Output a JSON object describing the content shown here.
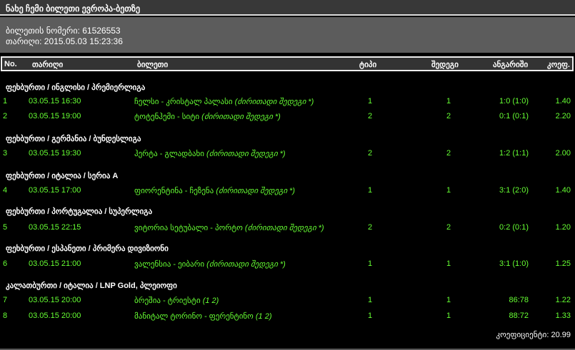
{
  "title": "ნახე ჩემი ბილეთი ევროპა-ბეთზე",
  "info": {
    "ticket_label": "ბილეთის ნომერი:",
    "ticket_number": "61526553",
    "date_label": "თარიღი:",
    "date": "2015.05.03 15:23:36"
  },
  "headers": {
    "no": "No.",
    "date": "თარიღი",
    "ticket": "ბილეთი",
    "type": "ტიპი",
    "result": "შედეგი",
    "score": "ანგარიში",
    "coef": "კოეფ."
  },
  "colors": {
    "row_text": "#66ff33",
    "title_bg": "#383838",
    "info_bg": "#5c5c5c"
  },
  "groups": [
    {
      "label": "ფეხბურთი / ინგლისი / პრემიერლიგა",
      "rows": [
        {
          "no": "1",
          "date": "03.05.15 16:30",
          "match": "ჩელსი - კრისტალ პალასი",
          "note": "(ძირითადი შედეგი *)",
          "type": "1",
          "result": "1",
          "score": "1:0 (1:0)",
          "coef": "1.40"
        },
        {
          "no": "2",
          "date": "03.05.15 19:00",
          "match": "ტოტენჰემი - სიტი",
          "note": "(ძირითადი შედეგი *)",
          "type": "2",
          "result": "2",
          "score": "0:1 (0:1)",
          "coef": "2.20"
        }
      ]
    },
    {
      "label": "ფეხბურთი / გერმანია / ბუნდესლიგა",
      "rows": [
        {
          "no": "3",
          "date": "03.05.15 19:30",
          "match": "ჰერტა - გლადბახი",
          "note": "(ძირითადი შედეგი *)",
          "type": "2",
          "result": "2",
          "score": "1:2 (1:1)",
          "coef": "2.00"
        }
      ]
    },
    {
      "label": "ფეხბურთი / იტალია / სერია A",
      "rows": [
        {
          "no": "4",
          "date": "03.05.15 17:00",
          "match": "ფიორენტინა - ჩეზენა",
          "note": "(ძირითადი შედეგი *)",
          "type": "1",
          "result": "1",
          "score": "3:1 (2:0)",
          "coef": "1.40"
        }
      ]
    },
    {
      "label": "ფეხბურთი / პორტუგალია / სუპერლიგა",
      "rows": [
        {
          "no": "5",
          "date": "03.05.15 22:15",
          "match": "ვიტორია სეტუბალი - პორტო",
          "note": "(ძირითადი შედეგი *)",
          "type": "2",
          "result": "2",
          "score": "0:2 (0:1)",
          "coef": "1.20"
        }
      ]
    },
    {
      "label": "ფეხბურთი / ესპანეთი / პრიმერა დივიზიონი",
      "rows": [
        {
          "no": "6",
          "date": "03.05.15 21:00",
          "match": "ვალენსია - ეიბარი",
          "note": "(ძირითადი შედეგი *)",
          "type": "1",
          "result": "1",
          "score": "3:1 (1:0)",
          "coef": "1.25"
        }
      ]
    },
    {
      "label": "კალათბურთი / იტალია / LNP Gold, პლეიოფი",
      "rows": [
        {
          "no": "7",
          "date": "03.05.15 20:00",
          "match": "ბრეშია - ტრიესტი",
          "note": "(1 2)",
          "type": "1",
          "result": "1",
          "score": "86:78",
          "coef": "1.22"
        },
        {
          "no": "8",
          "date": "03.05.15 20:00",
          "match": "მანიტალ ტორინო - ფერენტინო",
          "note": "(1 2)",
          "type": "1",
          "result": "1",
          "score": "88:72",
          "coef": "1.33"
        }
      ]
    }
  ],
  "footer": {
    "label": "კოეფიციენტი:",
    "value": "20.99"
  }
}
